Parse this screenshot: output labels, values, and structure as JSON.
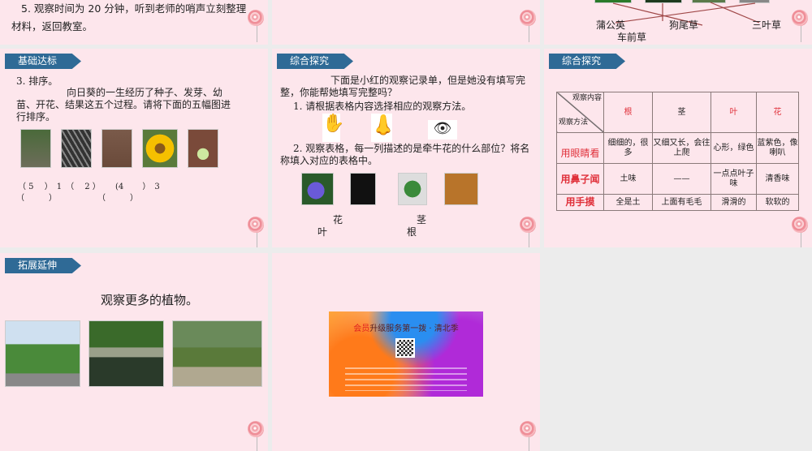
{
  "slide1": {
    "text": "5. 观察时间为 20 分钟，听到老师的哨声立刻整理材料，返回教室。"
  },
  "slide2": {
    "labels": [
      "蒲公英",
      "狗尾草",
      "三叶草",
      "车前草"
    ]
  },
  "slide3": {
    "tag": "基础达标",
    "heading": "3. 排序。",
    "body": "向日葵的一生经历了种子、发芽、幼苗、开花、结果这五个过程。请将下面的五幅图进行排序。",
    "answers_line1": "（ 5　 ）　1　（　 2 ）　　 (4　　 ）　3",
    "answers_line2": "（　　　）　　　　　　（　　　）"
  },
  "slide4": {
    "tag": "综合探究",
    "intro": "下面是小红的观察记录单，但是她没有填写完整，你能帮她填写完整吗？",
    "q1": "1. 请根据表格内容选择相应的观察方法。",
    "q2": "2. 观察表格，每一列描述的是牵牛花的什么部位？将名称填入对应的表格中。",
    "labels": [
      "花",
      "茎",
      "叶",
      "根"
    ],
    "icons": [
      "hand-icon",
      "nose-icon",
      "eye-icon"
    ]
  },
  "slide5": {
    "tag": "综合探究",
    "corner_top": "观察内容",
    "corner_bottom": "观察方法",
    "columns": [
      "根",
      "茎",
      "叶",
      "花"
    ],
    "rows": [
      {
        "method": "用眼睛看",
        "cells": [
          "细细的，很多",
          "又细又长，会往上爬",
          "心形，绿色",
          "蓝紫色，像喇叭"
        ]
      },
      {
        "method": "用鼻子闻",
        "cells": [
          "土味",
          "——",
          "一点点叶子味",
          "清香味"
        ]
      },
      {
        "method": "用手摸",
        "cells": [
          "全是土",
          "上面有毛毛",
          "滑滑的",
          "软软的"
        ]
      }
    ]
  },
  "slide6": {
    "tag": "拓展延伸",
    "text": "观察更多的植物。"
  },
  "slide7": {
    "ad_title_a": "会员",
    "ad_title_b": "升级服务第一拨 · 清北季"
  },
  "colors": {
    "slide_bg": "#fde6ec",
    "tag": "#2f6a96",
    "accent_red": "#e0303a",
    "gray": "#ececec"
  }
}
